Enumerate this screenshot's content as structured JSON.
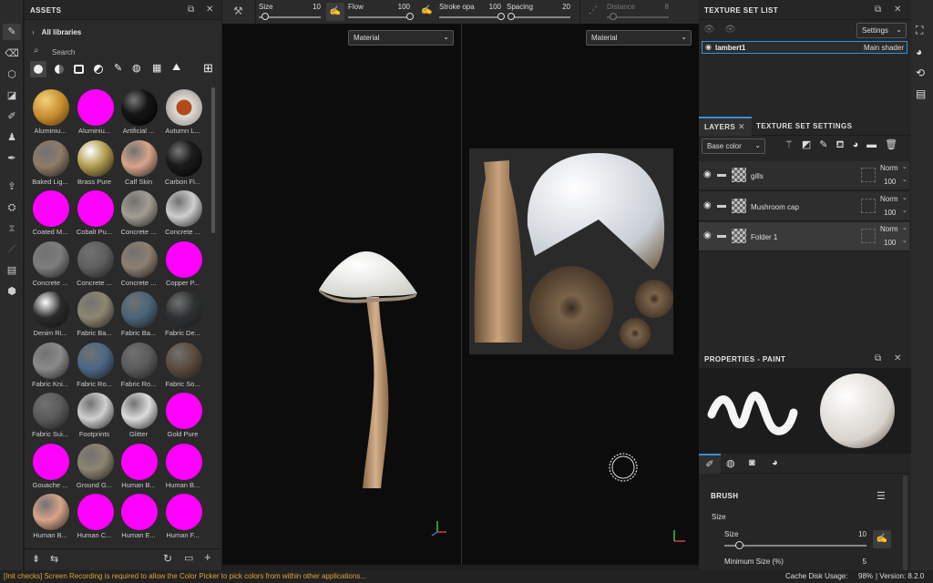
{
  "assets": {
    "title": "ASSETS",
    "all_libraries": "All libraries",
    "search_placeholder": "Search",
    "materials": [
      {
        "label": "Aluminiu...",
        "color": "#c58b2e",
        "type": "honey"
      },
      {
        "label": "Aluminiu...",
        "color": "#ff00ff",
        "type": "missing"
      },
      {
        "label": "Artificial ...",
        "color": "#151515",
        "type": "dark"
      },
      {
        "label": "Autumn L...",
        "color": "#e0dcd6",
        "type": "leaf"
      },
      {
        "label": "Baked Lig...",
        "color": "#8f7c68",
        "type": "plain"
      },
      {
        "label": "Brass Pure",
        "color": "#b29a4d",
        "type": "metal"
      },
      {
        "label": "Calf Skin",
        "color": "#d8a48a",
        "type": "plain"
      },
      {
        "label": "Carbon Fi...",
        "color": "#1c1c1c",
        "type": "dark"
      },
      {
        "label": "Coated M...",
        "color": "#ff00ff",
        "type": "missing"
      },
      {
        "label": "Cobalt Pu...",
        "color": "#ff00ff",
        "type": "missing"
      },
      {
        "label": "Concrete ...",
        "color": "#a39d92",
        "type": "plain"
      },
      {
        "label": "Concrete ...",
        "color": "#cfcfcf",
        "type": "plain"
      },
      {
        "label": "Concrete ...",
        "color": "#7d7d7d",
        "type": "plain"
      },
      {
        "label": "Concrete ...",
        "color": "#5f5f5f",
        "type": "plain"
      },
      {
        "label": "Concrete ...",
        "color": "#8d7e70",
        "type": "plain"
      },
      {
        "label": "Copper P...",
        "color": "#ff00ff",
        "type": "missing"
      },
      {
        "label": "Denim Ri...",
        "color": "#2a2a2a",
        "type": "metal"
      },
      {
        "label": "Fabric Ba...",
        "color": "#8d8670",
        "type": "plain"
      },
      {
        "label": "Fabric Ba...",
        "color": "#4a6479",
        "type": "plain"
      },
      {
        "label": "Fabric De...",
        "color": "#2e3133",
        "type": "plain"
      },
      {
        "label": "Fabric Kni...",
        "color": "#8a8a8a",
        "type": "plain"
      },
      {
        "label": "Fabric Ro...",
        "color": "#4b6886",
        "type": "plain"
      },
      {
        "label": "Fabric Ro...",
        "color": "#5b5b5b",
        "type": "plain"
      },
      {
        "label": "Fabric So...",
        "color": "#5d4a3e",
        "type": "plain"
      },
      {
        "label": "Fabric Sui...",
        "color": "#5a5a5a",
        "type": "plain"
      },
      {
        "label": "Footprints",
        "color": "#cfcfcf",
        "type": "plain"
      },
      {
        "label": "Glitter",
        "color": "#dcdcdc",
        "type": "plain"
      },
      {
        "label": "Gold Pure",
        "color": "#ff00ff",
        "type": "missing"
      },
      {
        "label": "Gouache ...",
        "color": "#ff00ff",
        "type": "missing"
      },
      {
        "label": "Ground G...",
        "color": "#8d8471",
        "type": "plain"
      },
      {
        "label": "Human B...",
        "color": "#ff00ff",
        "type": "missing"
      },
      {
        "label": "Human B...",
        "color": "#ff00ff",
        "type": "missing"
      },
      {
        "label": "Human B...",
        "color": "#d8a48a",
        "type": "plain"
      },
      {
        "label": "Human C...",
        "color": "#ff00ff",
        "type": "missing"
      },
      {
        "label": "Human E...",
        "color": "#ff00ff",
        "type": "missing"
      },
      {
        "label": "Human F...",
        "color": "#ff00ff",
        "type": "missing"
      }
    ]
  },
  "toolbar": {
    "size_label": "Size",
    "size_value": "10",
    "size_level": 0.1,
    "flow_label": "Flow",
    "flow_value": "100",
    "flow_level": 1,
    "stroke_label": "Stroke opa",
    "stroke_value": "100",
    "stroke_level": 1,
    "spacing_label": "Spacing",
    "spacing_value": "20",
    "spacing_level": 0.05,
    "distance_label": "Distance",
    "distance_value": "8",
    "distance_level": 0.1
  },
  "viewport": {
    "left_dropdown": "Material",
    "right_dropdown": "Material"
  },
  "texture_set_list": {
    "title": "TEXTURE SET LIST",
    "settings": "Settings",
    "item_name": "lambert1",
    "item_shader": "Main shader"
  },
  "layers": {
    "tab_layers": "LAYERS",
    "tab_tss": "TEXTURE SET SETTINGS",
    "channel": "Base color",
    "items": [
      {
        "name": "gills",
        "blend": "Norm",
        "opacity": "100"
      },
      {
        "name": "Mushroom cap",
        "blend": "Norm",
        "opacity": "100"
      },
      {
        "name": "Folder 1",
        "blend": "Norm",
        "opacity": "100"
      }
    ]
  },
  "properties": {
    "title": "PROPERTIES - PAINT",
    "section": "BRUSH",
    "size_heading": "Size",
    "size_label": "Size",
    "size_value": "10",
    "size_level": 0.1,
    "min_size_label": "Minimum Size (%)",
    "min_size_value": "5"
  },
  "status": {
    "message": "[Init checks] Screen Recording is required to allow the Color Picker to pick colors from within other applications...",
    "cache_label": "Cache Disk Usage:",
    "cache_value": "98%",
    "version": "| Version: 8.2.0"
  },
  "colors": {
    "accent": "#3a8fd6",
    "missing": "#ff00ff",
    "status_text": "#e0a23c"
  }
}
